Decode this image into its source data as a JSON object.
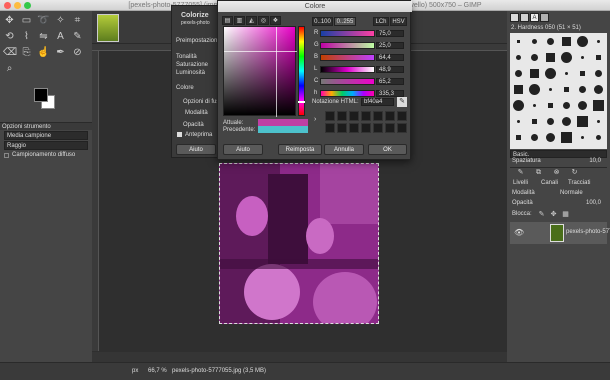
{
  "window": {
    "title": "[pexels-photo-5777055] (importata)-1.0 (Colore RGB 8-bit gamma, GIMP built-in sRGB, 1 livello) 500x750 – GIMP"
  },
  "toolbox": {
    "icons": [
      "move-icon",
      "rect-select-icon",
      "lasso-icon",
      "fuzzy-select-icon",
      "crop-icon",
      "transform-icon",
      "warp-icon",
      "flip-icon",
      "text-icon",
      "paintbrush-icon",
      "eraser-icon",
      "clone-icon",
      "smudge-icon",
      "path-icon",
      "color-picker-icon",
      "zoom-icon"
    ],
    "fg_color": "#000000",
    "bg_color": "#ffffff"
  },
  "tool_options": {
    "title": "Opzioni strumento",
    "mode_label": "Media campione",
    "radius_label": "Raggio",
    "sample_merged": "Campionamento diffuso"
  },
  "colorize": {
    "title": "Colorize",
    "subtitle": "pexels-photo",
    "presets": "Preimpostazioni",
    "hue": "Tonalità",
    "saturation": "Saturazione",
    "lightness": "Luminosità",
    "color": "Colore",
    "blending": "Opzioni di fusione",
    "mode": "Modalità",
    "opacity": "Opacità",
    "preview": "Anteprima",
    "help": "Aiuto"
  },
  "color_dialog": {
    "title": "Colore",
    "tabs": [
      "0..100",
      "0..255",
      "LCh",
      "HSV"
    ],
    "channels": [
      {
        "label": "R",
        "value": "75,0"
      },
      {
        "label": "G",
        "value": "25,0"
      },
      {
        "label": "B",
        "value": "64,4"
      },
      {
        "label": "L",
        "value": "48,9"
      },
      {
        "label": "C",
        "value": "65,2"
      },
      {
        "label": "h",
        "value": "335,3"
      }
    ],
    "html_label": "Notazione HTML:",
    "html_value": "bf40a4",
    "current_label": "Attuale:",
    "previous_label": "Precedente:",
    "current_color": "#bf40a4",
    "previous_color": "#4dc1cc",
    "buttons": {
      "help": "Aiuto",
      "reset": "Reimposta",
      "cancel": "Annulla",
      "ok": "OK"
    }
  },
  "brushes": {
    "title": "2. Hardness 050 (51 × 51)",
    "category": "Basic.",
    "spacing_label": "Spaziatura",
    "spacing_value": "10,0"
  },
  "layers": {
    "tabs": [
      "Livelli",
      "Canali",
      "Tracciati"
    ],
    "mode_label": "Modalità",
    "mode_value": "Normale",
    "opacity_label": "Opacità",
    "opacity_value": "100,0",
    "lock_label": "Blocca:",
    "layer_name": "pexels-photo-5777"
  },
  "statusbar": {
    "unit": "px",
    "zoom": "66,7 %",
    "file": "pexels-photo-5777055.jpg (3,5 MB)"
  }
}
